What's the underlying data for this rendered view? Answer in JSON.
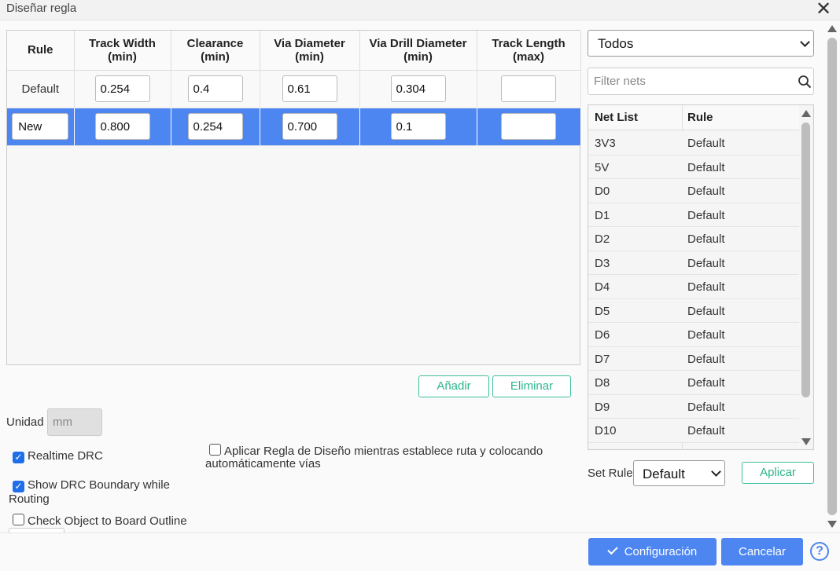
{
  "window": {
    "title": "Diseñar regla",
    "close_glyph": "✕"
  },
  "rules_table": {
    "headers": [
      {
        "line1": "Rule",
        "line2": ""
      },
      {
        "line1": "Track Width",
        "line2": "(min)"
      },
      {
        "line1": "Clearance",
        "line2": "(min)"
      },
      {
        "line1": "Via Diameter",
        "line2": "(min)"
      },
      {
        "line1": "Via Drill Diameter",
        "line2": "(min)"
      },
      {
        "line1": "Track Length",
        "line2": "(max)"
      }
    ],
    "rows": [
      {
        "name": "Default",
        "name_editable": false,
        "track_width": "0.254",
        "clearance": "0.4",
        "via_diameter": "0.61",
        "via_drill": "0.304",
        "track_length": "",
        "selected": false
      },
      {
        "name": "New",
        "name_editable": true,
        "track_width": "0.800",
        "clearance": "0.254",
        "via_diameter": "0.700",
        "via_drill": "0.1",
        "track_length": "",
        "selected": true
      }
    ]
  },
  "buttons": {
    "add": "Añadir",
    "delete": "Eliminar",
    "apply": "Aplicar",
    "config": "Configuración",
    "cancel": "Cancelar"
  },
  "unit": {
    "label": "Unidad",
    "value": "mm"
  },
  "options": {
    "realtime_drc": {
      "label": "Realtime DRC",
      "checked": true
    },
    "show_boundary": {
      "label_line1": "Show DRC Boundary while",
      "label_line2": "Routing",
      "checked": true
    },
    "check_outline": {
      "label": "Check Object to Board Outline",
      "checked": false
    },
    "apply_rule": {
      "label_line1": "Aplicar Regla de Diseño mientras establece ruta y colocando",
      "label_line2": "automáticamente vías",
      "checked": false
    }
  },
  "net_filter": {
    "selected": "Todos",
    "search_placeholder": "Filter nets"
  },
  "net_table": {
    "headers": {
      "net": "Net List",
      "rule": "Rule"
    },
    "rows": [
      {
        "net": "3V3",
        "rule": "Default"
      },
      {
        "net": "5V",
        "rule": "Default"
      },
      {
        "net": "D0",
        "rule": "Default"
      },
      {
        "net": "D1",
        "rule": "Default"
      },
      {
        "net": "D2",
        "rule": "Default"
      },
      {
        "net": "D3",
        "rule": "Default"
      },
      {
        "net": "D4",
        "rule": "Default"
      },
      {
        "net": "D5",
        "rule": "Default"
      },
      {
        "net": "D6",
        "rule": "Default"
      },
      {
        "net": "D7",
        "rule": "Default"
      },
      {
        "net": "D8",
        "rule": "Default"
      },
      {
        "net": "D9",
        "rule": "Default"
      },
      {
        "net": "D10",
        "rule": "Default"
      }
    ]
  },
  "set_rule": {
    "label": "Set Rule",
    "selected": "Default"
  },
  "help": {
    "glyph": "?"
  },
  "colors": {
    "accent": "#4d86f0",
    "outline_button": "#2db58e",
    "checkbox": "#1f6feb"
  }
}
